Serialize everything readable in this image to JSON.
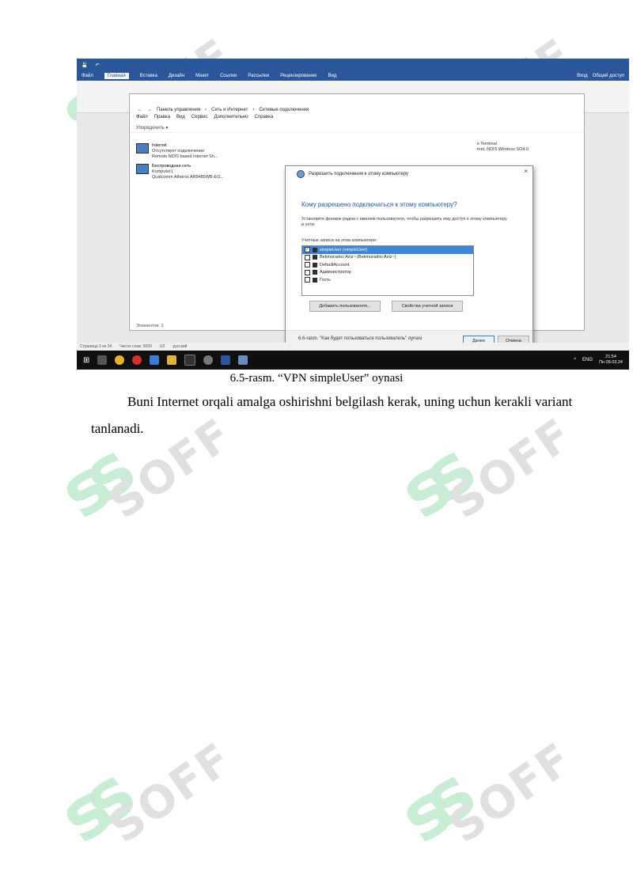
{
  "watermark": {
    "text": "SOFF",
    "mark": "ss"
  },
  "screenshot": {
    "ribbon_tabs": [
      "Файл",
      "Главная",
      "Вставка",
      "Дизайн",
      "Макет",
      "Ссылки",
      "Рассылки",
      "Рецензирование",
      "Вид"
    ],
    "ribbon_right": [
      "Вход",
      "Общий доступ"
    ],
    "explorer": {
      "address": [
        "Панель управления",
        "Сеть и Интернет",
        "Сетевые подключения"
      ],
      "menu": [
        "Файл",
        "Правка",
        "Вид",
        "Сервис",
        "Дополнительно",
        "Справка"
      ],
      "organize": "Упорядочить ▾",
      "connections": [
        {
          "name": "Internet",
          "lines": [
            "Отсутствует подключение",
            "Remote NDIS based Internet Sh..."
          ]
        },
        {
          "name": "Беспроводная сеть",
          "lines": [
            "Komputer1",
            "Qualcomm Atheros AR9485WB-EG..."
          ]
        }
      ],
      "right_text": [
        "o Terminal",
        "rnet, NDIS Wireless SO4.0"
      ],
      "status": "Элементов: 3"
    },
    "dialog": {
      "title": "Разрешить подключения к этому компьютеру",
      "question": "Кому разрешено подключаться к этому компьютеру?",
      "instruction": "Установите флажок рядом с именем пользователя, чтобы разрешить ему доступ к этому компьютеру и сети.",
      "list_label": "Учетные записи на этом компьютере:",
      "accounts": [
        {
          "label": "simpleUser (simpleUser)",
          "checked": true,
          "selected": true
        },
        {
          "label": "Bekmuradov Aziz~ (Bekmuradov Aziz~)",
          "checked": false,
          "selected": false
        },
        {
          "label": "DefaultAccount",
          "checked": false,
          "selected": false
        },
        {
          "label": "Администратор",
          "checked": false,
          "selected": false
        },
        {
          "label": "Гость",
          "checked": false,
          "selected": false
        }
      ],
      "add_user": "Добавить пользователя...",
      "account_props": "Свойства учетной записи",
      "next": "Далее",
      "cancel": "Отмена"
    },
    "word_status": [
      "Страница 3 из 34",
      "Число слов: 5030",
      "UZ",
      "русский"
    ],
    "doc_caption": "6.6-rasm. \"Kак будет пользоваться пользователь\" oynasi",
    "tray": {
      "lang": "ENG",
      "time": "21:54",
      "date": "Пн 09.03.24"
    }
  },
  "caption": "6.5-rasm. “VPN simpleUser” oynasi",
  "paragraph": "Buni Internet orqali amalga oshirishni belgilash kerak, uning uchun kerakli variant tanlanadi."
}
